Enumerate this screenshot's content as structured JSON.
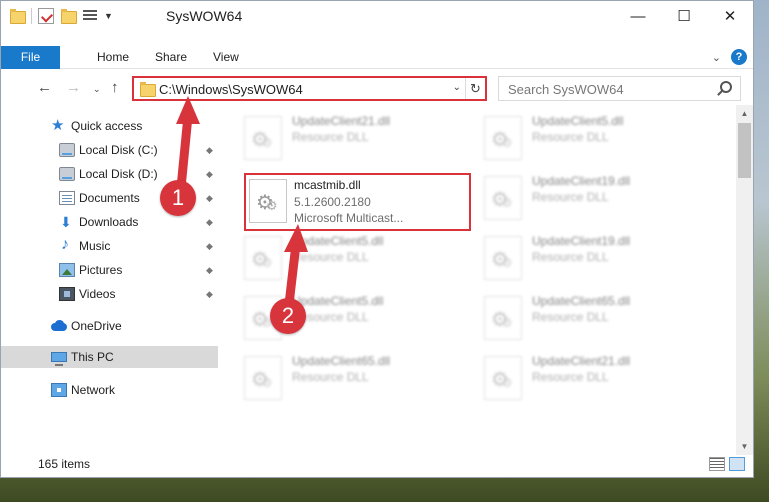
{
  "window": {
    "title": "SysWOW64",
    "controls": {
      "minimize": "—",
      "maximize": "☐",
      "close": "✕"
    }
  },
  "ribbon": {
    "tabs": [
      "File",
      "Home",
      "Share",
      "View"
    ],
    "collapse": "⌄",
    "help": "?"
  },
  "nav": {
    "back": "←",
    "forward": "→",
    "recent": "⌄",
    "up": "↑",
    "address": "C:\\Windows\\SysWOW64",
    "address_dropdown": "⌄",
    "refresh": "↻",
    "search_placeholder": "Search SysWOW64"
  },
  "sidebar": {
    "items": [
      {
        "label": "Quick access",
        "icon": "star-icon"
      },
      {
        "label": "Local Disk (C:)",
        "icon": "disk-icon",
        "pinned": true
      },
      {
        "label": "Local Disk (D:)",
        "icon": "disk-icon",
        "pinned": true
      },
      {
        "label": "Documents",
        "icon": "documents-icon",
        "pinned": true
      },
      {
        "label": "Downloads",
        "icon": "download-icon",
        "pinned": true
      },
      {
        "label": "Music",
        "icon": "music-icon",
        "pinned": true
      },
      {
        "label": "Pictures",
        "icon": "pictures-icon",
        "pinned": true
      },
      {
        "label": "Videos",
        "icon": "video-icon",
        "pinned": true
      },
      {
        "label": "OneDrive",
        "icon": "cloud-icon"
      },
      {
        "label": "This PC",
        "icon": "pc-icon",
        "selected": true
      },
      {
        "label": "Network",
        "icon": "network-icon"
      }
    ],
    "pin_glyph": "📌"
  },
  "files": {
    "highlighted": {
      "name": "mcastmib.dll",
      "version": "5.1.2600.2180",
      "description": "Microsoft Multicast..."
    },
    "left_column": [
      {
        "name": "UpdateClient21.dll",
        "type": "Resource DLL"
      },
      {
        "name": "UpdateClient5.dll",
        "type": "Resource DLL"
      },
      {
        "name": "UpdateClient5.dll",
        "type": "Resource DLL"
      },
      {
        "name": "UpdateClient65.dll",
        "type": "Resource DLL"
      }
    ],
    "right_column": [
      {
        "name": "UpdateClient5.dll",
        "type": "Resource DLL"
      },
      {
        "name": "UpdateClient19.dll",
        "type": "Resource DLL"
      },
      {
        "name": "UpdateClient19.dll",
        "type": "Resource DLL"
      },
      {
        "name": "UpdateClient65.dll",
        "type": "Resource DLL"
      },
      {
        "name": "UpdateClient21.dll",
        "type": "Resource DLL"
      }
    ]
  },
  "status": {
    "items_count": "165 items"
  },
  "annotations": {
    "step1": "1",
    "step2": "2",
    "color": "#d8343c"
  }
}
